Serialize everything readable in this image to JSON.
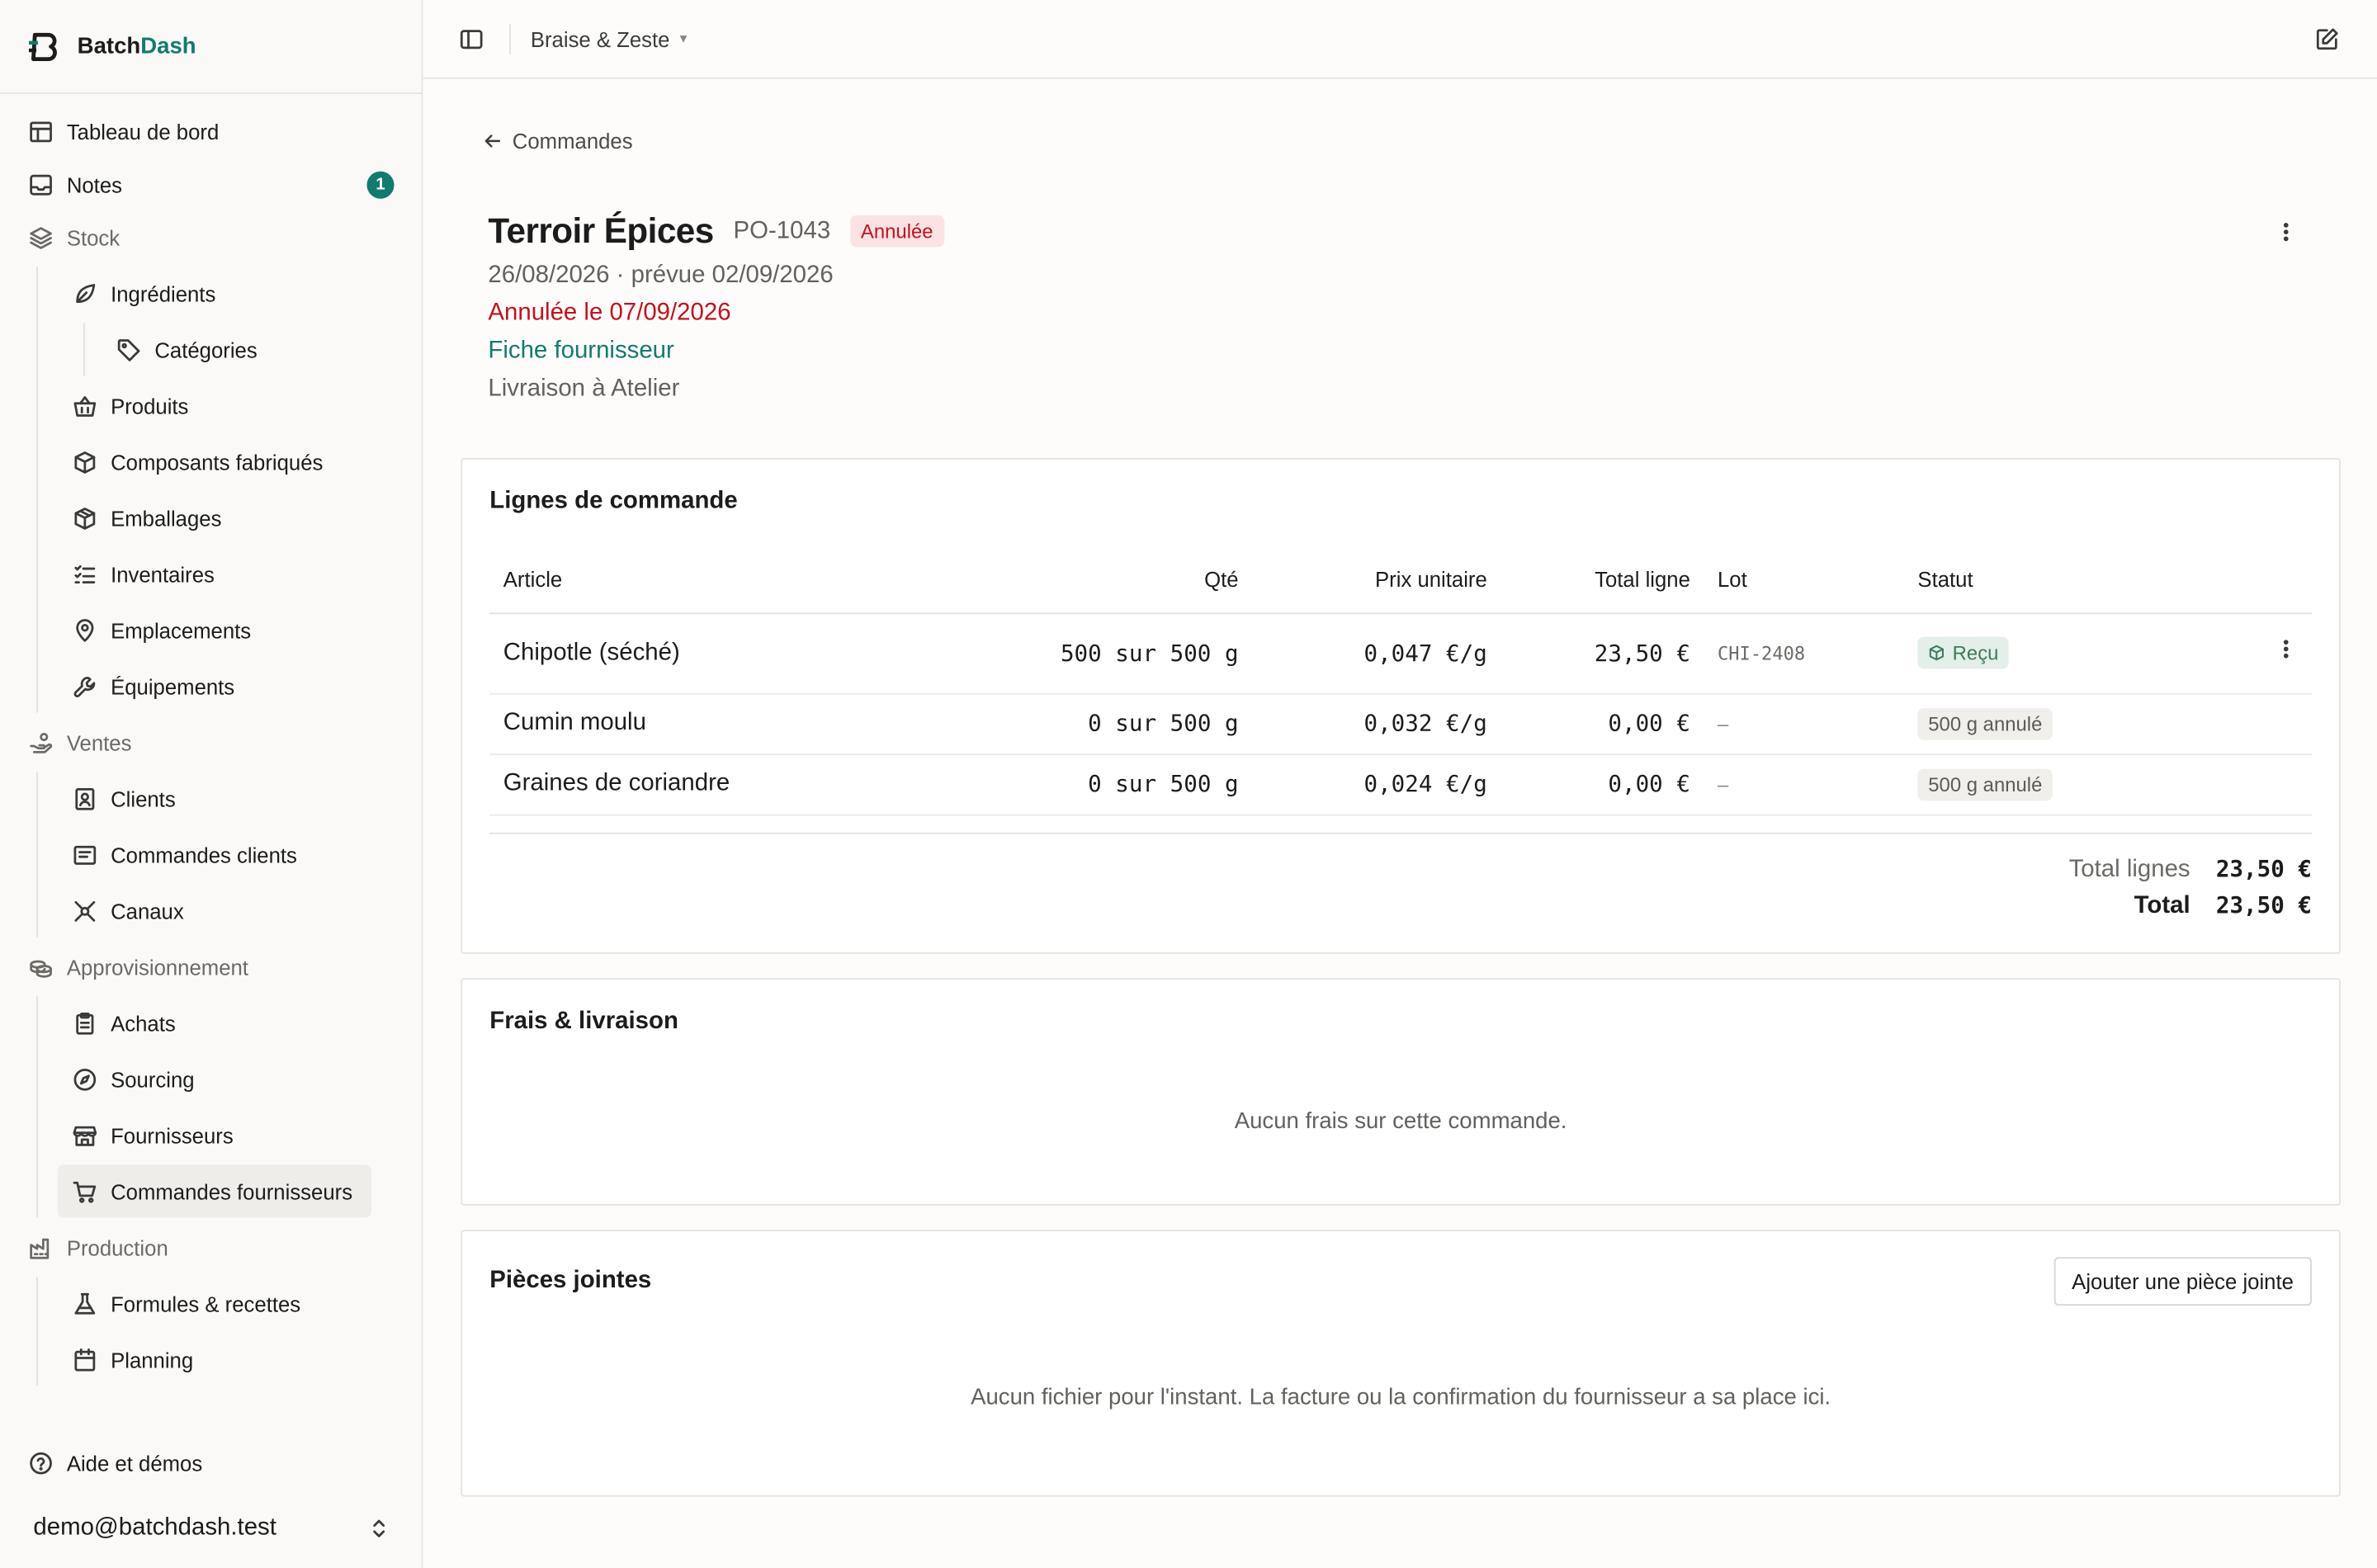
{
  "app": {
    "name_part1": "Batch",
    "name_part2": "Dash",
    "accent_color": "#137a6f"
  },
  "sidebar": {
    "dashboard": "Tableau de bord",
    "notes": {
      "label": "Notes",
      "count": "1"
    },
    "stock": {
      "label": "Stock",
      "ingredients": "Ingrédients",
      "categories": "Catégories",
      "products": "Produits",
      "manufactured": "Composants fabriqués",
      "packaging": "Emballages",
      "inventories": "Inventaires",
      "locations": "Emplacements",
      "equipment": "Équipements"
    },
    "sales": {
      "label": "Ventes",
      "clients": "Clients",
      "client_orders": "Commandes clients",
      "channels": "Canaux"
    },
    "supply": {
      "label": "Approvisionnement",
      "purchases": "Achats",
      "sourcing": "Sourcing",
      "suppliers": "Fournisseurs",
      "supplier_orders": "Commandes fournisseurs"
    },
    "production": {
      "label": "Production",
      "formulas": "Formules & recettes",
      "planning": "Planning"
    },
    "help": "Aide et démos",
    "user_email": "demo@batchdash.test"
  },
  "topbar": {
    "workspace": "Braise & Zeste"
  },
  "page": {
    "back_label": "Commandes",
    "title": "Terroir Épices",
    "ref": "PO-1043",
    "status": "Annulée",
    "dates": "26/08/2026 · prévue 02/09/2026",
    "cancelled": "Annulée le 07/09/2026",
    "supplier_link": "Fiche fournisseur",
    "delivery": "Livraison à Atelier"
  },
  "lines": {
    "title": "Lignes de commande",
    "headers": {
      "article": "Article",
      "qty": "Qté",
      "unit_price": "Prix unitaire",
      "line_total": "Total ligne",
      "lot": "Lot",
      "status": "Statut"
    },
    "rows": [
      {
        "article": "Chipotle (séché)",
        "qty": "500 sur 500 g",
        "unit_price": "0,047 €/g",
        "total": "23,50 €",
        "lot": "CHI-2408",
        "status": "Reçu"
      },
      {
        "article": "Cumin moulu",
        "qty": "0 sur 500 g",
        "unit_price": "0,032 €/g",
        "total": "0,00 €",
        "lot": "–",
        "status": "500 g annulé"
      },
      {
        "article": "Graines de coriandre",
        "qty": "0 sur 500 g",
        "unit_price": "0,024 €/g",
        "total": "0,00 €",
        "lot": "–",
        "status": "500 g annulé"
      }
    ],
    "total_lines_label": "Total lignes",
    "total_lines_value": "23,50 €",
    "total_label": "Total",
    "total_value": "23,50 €"
  },
  "fees": {
    "title": "Frais & livraison",
    "empty": "Aucun frais sur cette commande."
  },
  "attachments": {
    "title": "Pièces jointes",
    "add_button": "Ajouter une pièce jointe",
    "empty": "Aucun fichier pour l'instant. La facture ou la confirmation du fournisseur a sa place ici."
  }
}
